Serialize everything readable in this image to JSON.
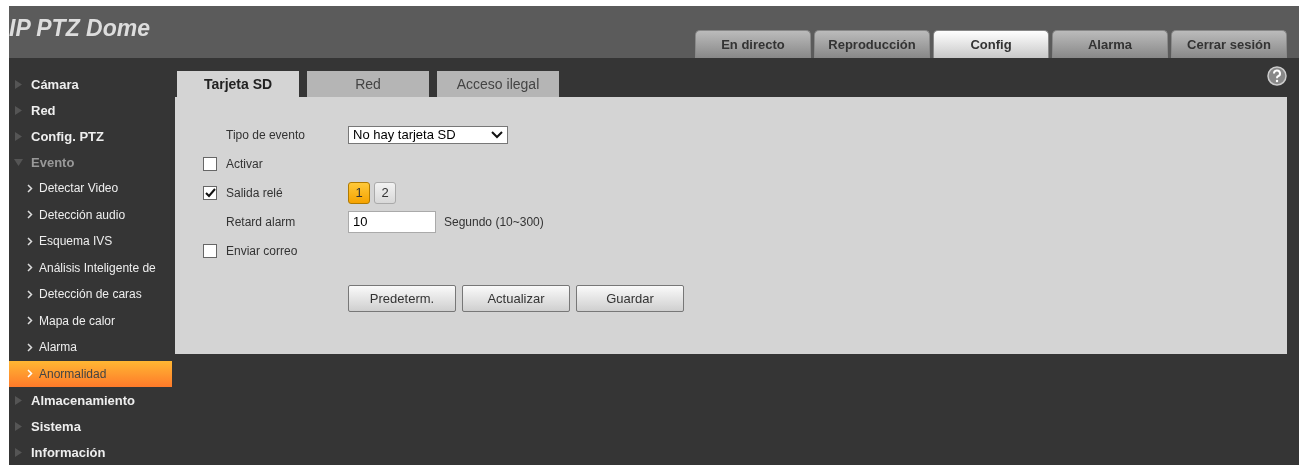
{
  "header": {
    "title": "IP PTZ Dome"
  },
  "nav_tabs": [
    {
      "label": "En directo",
      "selected": false
    },
    {
      "label": "Reproducción",
      "selected": false
    },
    {
      "label": "Config",
      "selected": true
    },
    {
      "label": "Alarma",
      "selected": false
    },
    {
      "label": "Cerrar sesión",
      "selected": false
    }
  ],
  "sidebar": {
    "items": [
      {
        "label": "Cámara",
        "expanded": false,
        "selected": false
      },
      {
        "label": "Red",
        "expanded": false,
        "selected": false
      },
      {
        "label": "Config. PTZ",
        "expanded": false,
        "selected": false
      },
      {
        "label": "Evento",
        "expanded": true,
        "selected": false,
        "children": [
          {
            "label": "Detectar Video",
            "selected": false
          },
          {
            "label": "Detección audio",
            "selected": false
          },
          {
            "label": "Esquema IVS",
            "selected": false
          },
          {
            "label": "Análisis Inteligente de",
            "selected": false
          },
          {
            "label": "Detección de caras",
            "selected": false
          },
          {
            "label": "Mapa de calor",
            "selected": false
          },
          {
            "label": "Alarma",
            "selected": false
          },
          {
            "label": "Anormalidad",
            "selected": true
          }
        ]
      },
      {
        "label": "Almacenamiento",
        "expanded": false,
        "selected": false
      },
      {
        "label": "Sistema",
        "expanded": false,
        "selected": false
      },
      {
        "label": "Información",
        "expanded": false,
        "selected": false
      }
    ]
  },
  "content_tabs": [
    {
      "label": "Tarjeta SD",
      "selected": true
    },
    {
      "label": "Red",
      "selected": false
    },
    {
      "label": "Acceso ilegal",
      "selected": false
    }
  ],
  "form": {
    "rows": [
      {
        "kind": "select",
        "label": "Tipo de evento",
        "value": "No hay tarjeta SD"
      },
      {
        "kind": "checkbox",
        "label": "Activar",
        "checked": false
      },
      {
        "kind": "channels",
        "label": "Salida relé",
        "checked": true,
        "channels": [
          {
            "label": "1",
            "selected": true
          },
          {
            "label": "2",
            "selected": false
          }
        ]
      },
      {
        "kind": "input",
        "label": "Retard alarm",
        "value": "10",
        "hint": "Segundo (10~300)"
      },
      {
        "kind": "checkbox",
        "label": "Enviar correo",
        "checked": false
      }
    ],
    "buttons": [
      "Predeterm.",
      "Actualizar",
      "Guardar"
    ]
  }
}
